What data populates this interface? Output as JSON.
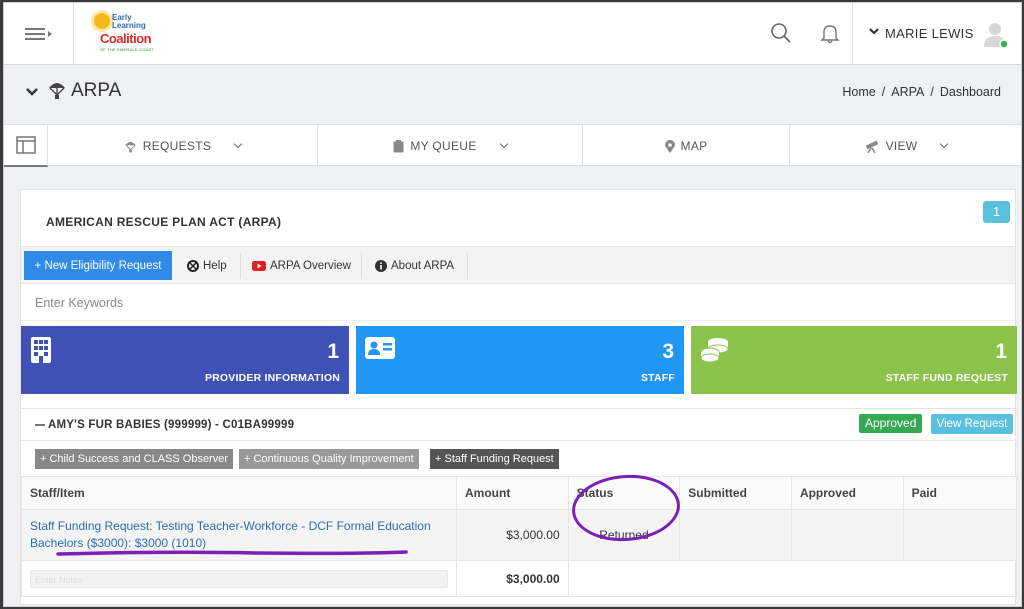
{
  "header": {
    "logo": {
      "line1": "Early",
      "line2": "Learning",
      "line3": "Coalition",
      "line4": "OF THE EMERALD COAST"
    },
    "user_name": "MARIE LEWIS"
  },
  "page": {
    "title": "ARPA",
    "breadcrumb": [
      "Home",
      "ARPA",
      "Dashboard"
    ]
  },
  "nav": {
    "items": [
      {
        "label": "REQUESTS",
        "icon": "parachute-icon",
        "has_caret": true
      },
      {
        "label": "MY QUEUE",
        "icon": "clipboard-icon",
        "has_caret": true
      },
      {
        "label": "MAP",
        "icon": "map-pin-icon",
        "has_caret": false
      },
      {
        "label": "VIEW",
        "icon": "telescope-icon",
        "has_caret": true
      }
    ]
  },
  "panel": {
    "title": "AMERICAN RESCUE PLAN ACT (ARPA)",
    "count": "1",
    "toolbar": {
      "new_request": "+ New Eligibility Request",
      "help": "Help",
      "overview": "ARPA Overview",
      "about": "About ARPA"
    },
    "keyword_placeholder": "Enter Keywords",
    "cards": [
      {
        "value": "1",
        "label": "PROVIDER INFORMATION",
        "color": "#3f51b5"
      },
      {
        "value": "3",
        "label": "STAFF",
        "color": "#2196f3"
      },
      {
        "value": "1",
        "label": "STAFF FUND REQUEST",
        "color": "#8bc34a"
      }
    ]
  },
  "provider": {
    "name": "AMY'S FUR BABIES (999999) - C01BA99999",
    "status_badge": "Approved",
    "view_button": "View Request",
    "tags": [
      "+ Child Success and CLASS Observer",
      "+ Continuous Quality Improvement",
      "+ Staff Funding Request"
    ],
    "table": {
      "headers": [
        "Staff/Item",
        "Amount",
        "Status",
        "Submitted",
        "Approved",
        "Paid"
      ],
      "row": {
        "item": "Staff Funding Request: Testing Teacher-Workforce - DCF Formal Education Bachelors ($3000): $3000 (1010)",
        "amount": "$3,000.00",
        "status": "Returned",
        "submitted": "",
        "approved": "",
        "paid": ""
      },
      "total": "$3,000.00",
      "notes_placeholder": "Enter Notes"
    }
  },
  "colors": {
    "primary": "#2f8ae8",
    "info": "#5bc0de",
    "success": "#34a853",
    "annotation": "#7c1fb6"
  }
}
